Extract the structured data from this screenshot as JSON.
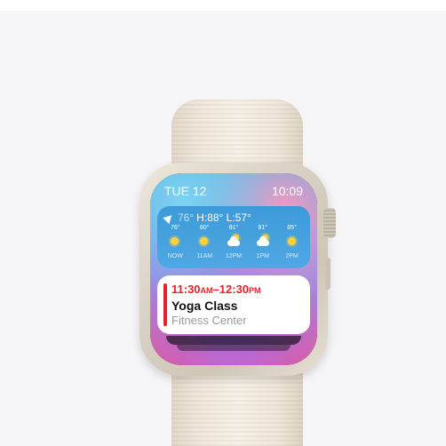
{
  "status": {
    "date": "TUE 12",
    "time": "10:09"
  },
  "weather": {
    "current_temp": "76°",
    "high_low": "H:88° L:57°",
    "hours": [
      {
        "temp": "76°",
        "icon": "sun-icon",
        "label": "NOW"
      },
      {
        "temp": "80°",
        "icon": "sun-icon",
        "label": "11AM"
      },
      {
        "temp": "81°",
        "icon": "partly-cloudy-icon",
        "label": "12PM"
      },
      {
        "temp": "81°",
        "icon": "partly-cloudy-icon",
        "label": "1PM"
      },
      {
        "temp": "85°",
        "icon": "sun-icon",
        "label": "2PM"
      }
    ]
  },
  "event": {
    "time_start": "11:30",
    "start_meridiem": "AM",
    "dash": "–",
    "time_end": "12:30",
    "end_meridiem": "PM",
    "title": "Yoga Class",
    "location": "Fitness Center",
    "accent_color": "#e8202a"
  }
}
